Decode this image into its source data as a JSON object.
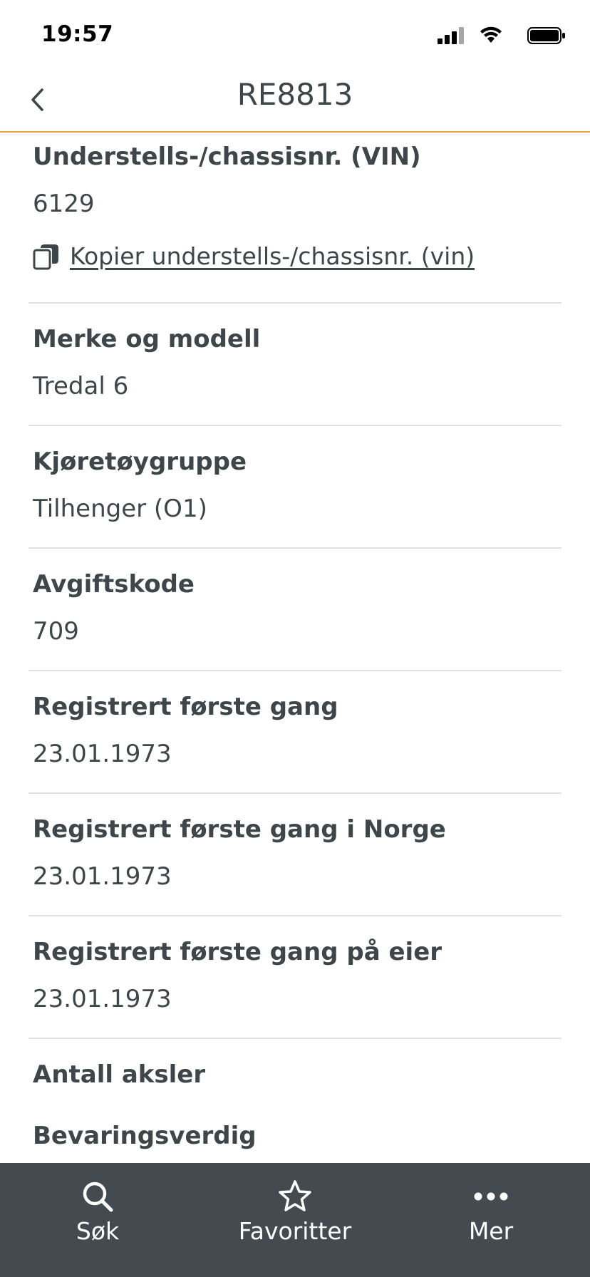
{
  "status_bar": {
    "time": "19:57"
  },
  "nav": {
    "title": "RE8813"
  },
  "vehicle": {
    "vin_label": "Understells-/chassisnr. (VIN)",
    "vin_value": "6129",
    "copy_vin_link": "Kopier understells-/chassisnr. (vin)",
    "make_model_label": "Merke og modell",
    "make_model_value": "Tredal 6",
    "vehicle_group_label": "Kjøretøygruppe",
    "vehicle_group_value": "Tilhenger (O1)",
    "fee_code_label": "Avgiftskode",
    "fee_code_value": "709",
    "first_reg_label": "Registrert første gang",
    "first_reg_value": "23.01.1973",
    "first_reg_norway_label": "Registrert første gang i Norge",
    "first_reg_norway_value": "23.01.1973",
    "first_reg_owner_label": "Registrert første gang på eier",
    "first_reg_owner_value": "23.01.1973",
    "axles_label": "Antall aksler",
    "preservation_label": "Bevaringsverdig"
  },
  "tabs": [
    {
      "label": "Søk",
      "icon": "search-icon"
    },
    {
      "label": "Favoritter",
      "icon": "star-icon"
    },
    {
      "label": "Mer",
      "icon": "more-icon"
    }
  ],
  "colors": {
    "accent": "#e0a93a",
    "tab_bar": "#434b50",
    "text": "#3e4649"
  }
}
